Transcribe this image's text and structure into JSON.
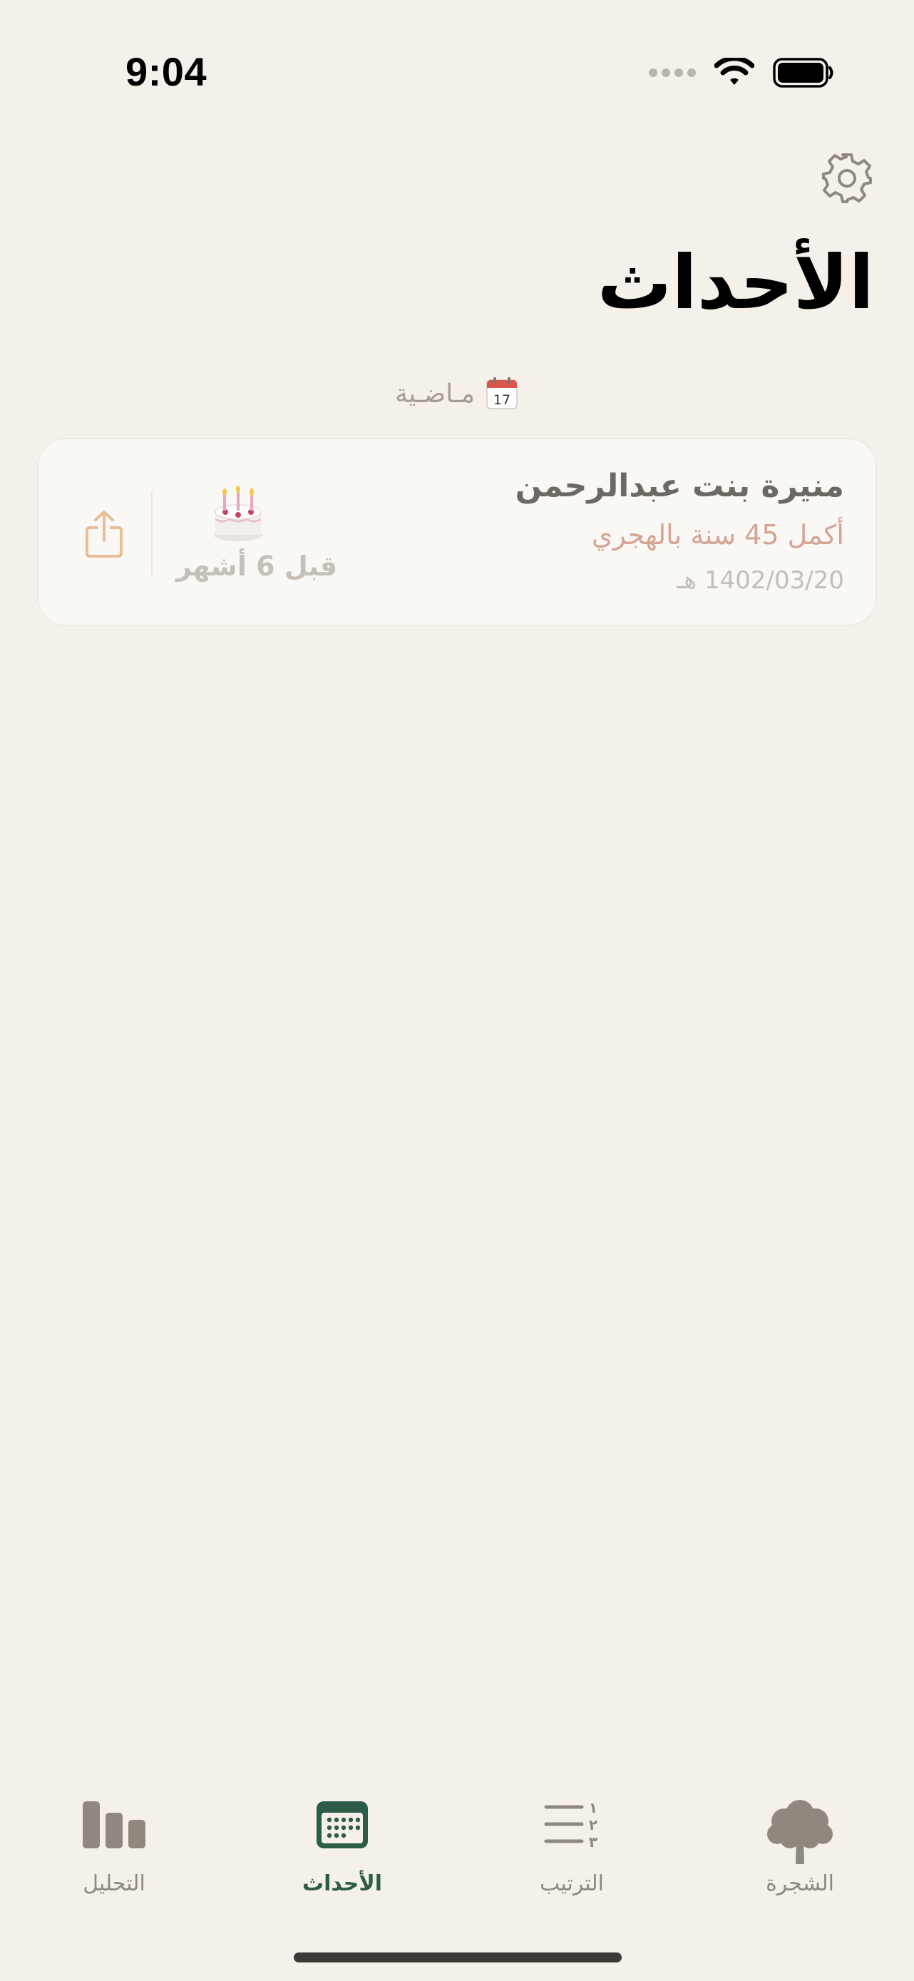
{
  "status_bar": {
    "time": "9:04"
  },
  "header": {
    "title": "الأحداث"
  },
  "section": {
    "label": "مـاضـية",
    "icon": "calendar-icon",
    "icon_day": "17"
  },
  "event": {
    "name": "منيرة بنت عبدالرحمن",
    "age_text": "أكمل 45 سنة بالهجري",
    "date": "1402/03/20 هـ",
    "ago": "قبل 6 أشهر",
    "icon": "birthday-cake-icon"
  },
  "tabs": [
    {
      "label": "التحليل",
      "icon": "bar-chart-icon",
      "active": false
    },
    {
      "label": "الأحداث",
      "icon": "calendar-icon",
      "active": true
    },
    {
      "label": "الترتيب",
      "icon": "ranked-list-icon",
      "active": false
    },
    {
      "label": "الشجرة",
      "icon": "tree-icon",
      "active": false
    }
  ],
  "colors": {
    "background": "#f5f1ea",
    "accent": "#2d5c46",
    "card": "#faf8f4",
    "age_text": "#d4a494",
    "share_icon": "#e6bf9a"
  }
}
